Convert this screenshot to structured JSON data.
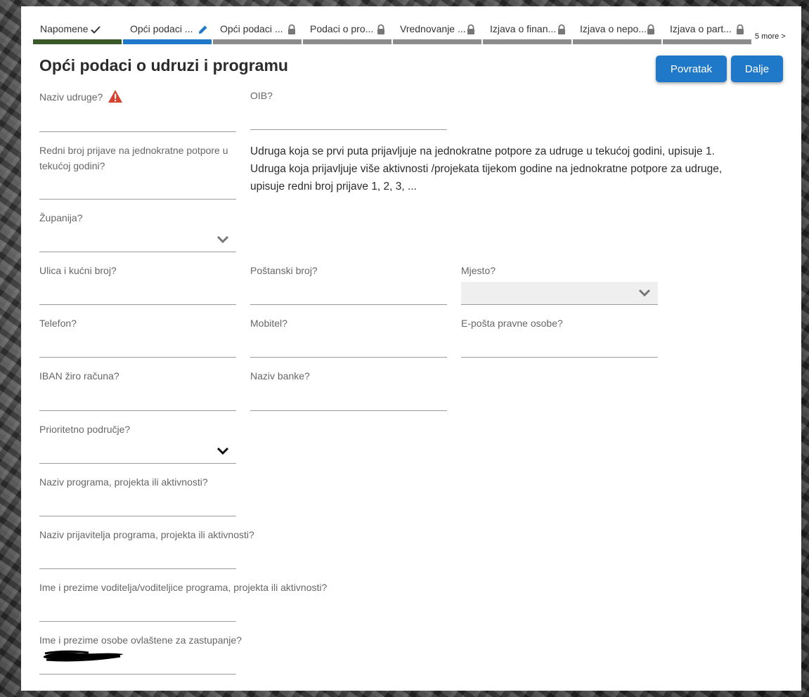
{
  "stepper": {
    "steps": [
      {
        "label": "Napomene",
        "state": "done",
        "icon": "check-icon"
      },
      {
        "label": "Opći podaci ...",
        "state": "active",
        "icon": "pencil-icon"
      },
      {
        "label": "Opći podaci ...",
        "state": "locked",
        "icon": "lock-icon"
      },
      {
        "label": "Podaci o pro...",
        "state": "locked",
        "icon": "lock-icon"
      },
      {
        "label": "Vrednovanje ...",
        "state": "locked",
        "icon": "lock-icon"
      },
      {
        "label": "Izjava o finan...",
        "state": "locked",
        "icon": "lock-icon"
      },
      {
        "label": "Izjava o nepo...",
        "state": "locked",
        "icon": "lock-icon"
      },
      {
        "label": "Izjava o part...",
        "state": "locked",
        "icon": "lock-icon"
      }
    ],
    "more_label": "5 more >"
  },
  "header": {
    "title": "Opći podaci o udruzi i programu",
    "back_label": "Povratak",
    "next_label": "Dalje"
  },
  "form": {
    "naziv_udruge": {
      "label": "Naziv udruge?",
      "value": ""
    },
    "oib": {
      "label": "OIB?",
      "value": ""
    },
    "redni_broj": {
      "label": "Redni broj prijave na jednokratne potpore u tekućoj godini?",
      "value": ""
    },
    "info_text": "Udruga koja se prvi puta prijavljuje na jednokratne potpore za udruge u tekućoj godini, upisuje 1. Udruga koja prijavljuje više aktivnosti /projekata tijekom godine na jednokratne potpore za udruge, upisuje redni broj prijave 1, 2, 3, ...",
    "zupanija": {
      "label": "Županija?",
      "value": ""
    },
    "ulica": {
      "label": "Ulica i kućni broj?",
      "value": ""
    },
    "postanski_broj": {
      "label": "Poštanski broj?",
      "value": ""
    },
    "mjesto": {
      "label": "Mjesto?",
      "value": ""
    },
    "telefon": {
      "label": "Telefon?",
      "value": ""
    },
    "mobitel": {
      "label": "Mobitel?",
      "value": ""
    },
    "eposta": {
      "label": "E-pošta pravne osobe?",
      "value": ""
    },
    "iban": {
      "label": "IBAN žiro računa?",
      "value": ""
    },
    "naziv_banke": {
      "label": "Naziv banke?",
      "value": ""
    },
    "prioritetno": {
      "label": "Prioritetno područje?",
      "value": ""
    },
    "naziv_programa": {
      "label": "Naziv programa, projekta ili aktivnosti?",
      "value": ""
    },
    "naziv_prijavitelja": {
      "label": "Naziv prijavitelja programa, projekta ili aktivnosti?",
      "value": ""
    },
    "voditelj": {
      "label": "Ime i prezime voditelja/voditeljice programa, projekta ili aktivnosti?",
      "value": ""
    },
    "ovlastena_osoba": {
      "label": "Ime i prezime osobe ovlaštene za zastupanje?"
    }
  },
  "colors": {
    "primary": "#1f79c8",
    "done": "#3b5a2a",
    "locked": "#8c8c8c",
    "warning": "#d9412f"
  }
}
